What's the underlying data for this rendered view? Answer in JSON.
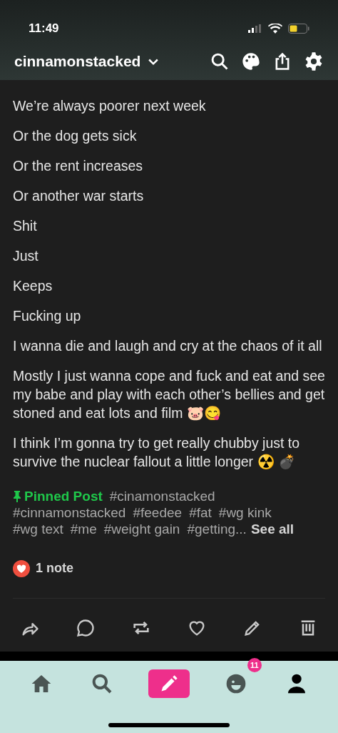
{
  "status_bar": {
    "time": "11:49"
  },
  "header": {
    "blog_name": "cinnamonstacked"
  },
  "post": {
    "lines": [
      "We’re always poorer next week",
      "Or the dog gets sick",
      "Or the rent increases",
      "Or another war starts",
      "Shit",
      "Just",
      "Keeps",
      "Fucking up",
      "I wanna die and laugh and cry at the chaos of it all",
      "Mostly I just wanna cope and fuck and eat and see my babe and play with each other’s bellies and get stoned and eat lots and film 🐷😋",
      "I think I’m gonna try to get really chubby just to survive the nuclear fallout a little longer ☢️ 💣"
    ]
  },
  "tags": {
    "pinned_label": "Pinned Post",
    "items": [
      "#cinamonstacked",
      "#cinnamonstacked",
      "#feedee",
      "#fat",
      "#wg kink",
      "#wg text",
      "#me",
      "#weight gain",
      "#getting..."
    ],
    "see_all": "See all"
  },
  "notes": {
    "count": "1 note"
  },
  "tab_bar": {
    "items": [
      {
        "kind": "home",
        "selected": false
      },
      {
        "kind": "search",
        "selected": false
      },
      {
        "kind": "create",
        "selected": false
      },
      {
        "kind": "activity",
        "selected": false,
        "badge": "11"
      },
      {
        "kind": "account",
        "selected": true
      }
    ]
  }
}
